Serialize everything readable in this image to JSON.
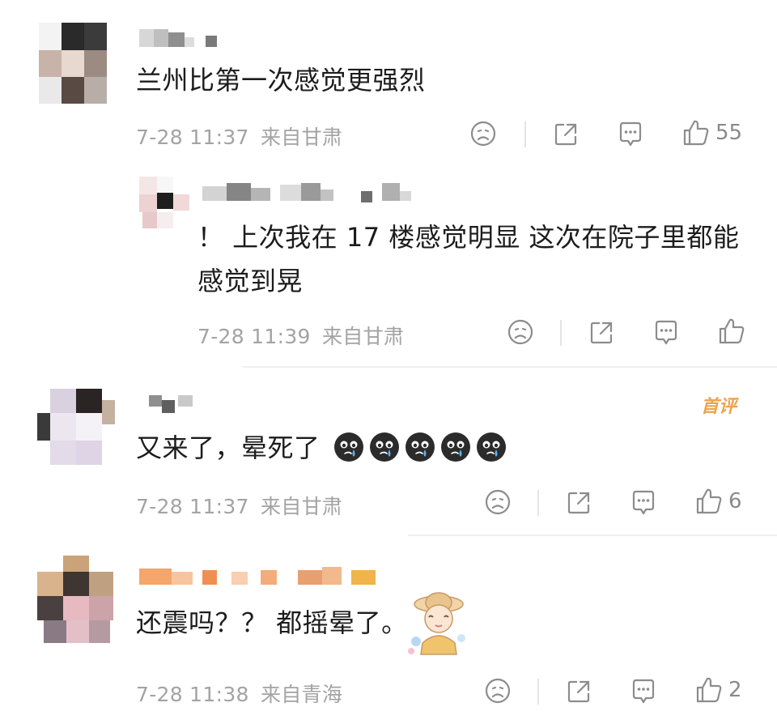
{
  "comments": [
    {
      "text": "兰州比第一次感觉更强烈",
      "time": "7-28 11:37",
      "location": "来自甘肃",
      "likes": "55",
      "avatar_colors": [
        "#f5f5f5",
        "#2b2b2b",
        "#ddd4ce",
        "#9a8a82",
        "#3a3a3a",
        "#ececec",
        "#c9b2a7",
        "#5b4b45",
        "#f0f0f0"
      ]
    },
    {
      "text": "！ 上次我在 17 楼感觉明显 这次在院子里都能感觉到晃",
      "time": "7-28 11:39",
      "location": "来自甘肃",
      "likes": ""
    },
    {
      "text": "又来了，晕死了",
      "time": "7-28 11:37",
      "location": "来自甘肃",
      "likes": "6",
      "badge": "首评",
      "emoji_count": 5
    },
    {
      "text": "还震吗？？ 都摇晕了。",
      "time": "7-28 11:38",
      "location": "来自青海",
      "likes": "2"
    }
  ],
  "icons": {
    "dislike": "sad-face-icon",
    "share": "share-icon",
    "comment": "comment-icon",
    "like": "thumbs-up-icon",
    "emoji": "crying-face-emoji",
    "sticker": "girl-with-hat-sticker"
  },
  "colors": {
    "text": "#1c1c1c",
    "meta": "#a3a3a3",
    "icon": "#8c8c8c",
    "badge": "#f0a24b",
    "username_orange": "#f19a52"
  }
}
